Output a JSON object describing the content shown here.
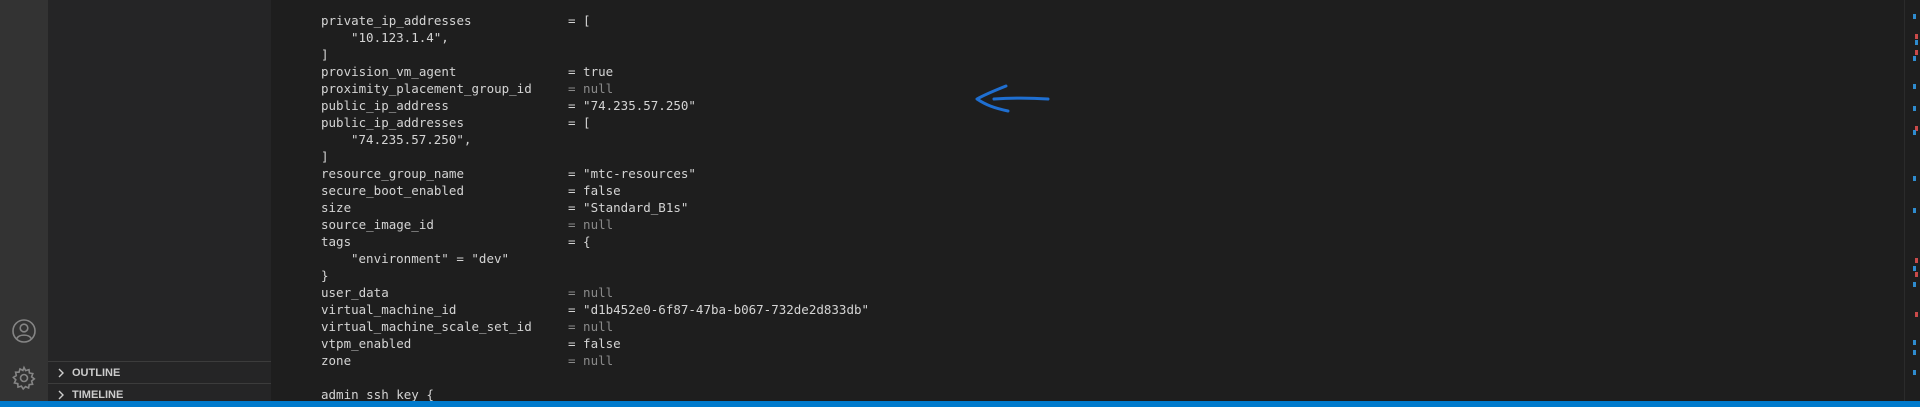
{
  "sidebar": {
    "outline_label": "OUTLINE",
    "timeline_label": "TIMELINE"
  },
  "code_lines": [
    {
      "key": "private_ip_addresses",
      "value": "= [",
      "dim": false
    },
    {
      "indent": "\"10.123.1.4\","
    },
    {
      "raw": "]"
    },
    {
      "key": "provision_vm_agent",
      "value": "= true",
      "dim": false
    },
    {
      "key": "proximity_placement_group_id",
      "value": "= null",
      "dim": true
    },
    {
      "key": "public_ip_address",
      "value": "= \"74.235.57.250\"",
      "dim": false
    },
    {
      "key": "public_ip_addresses",
      "value": "= [",
      "dim": false
    },
    {
      "indent": "\"74.235.57.250\","
    },
    {
      "raw": "]"
    },
    {
      "key": "resource_group_name",
      "value": "= \"mtc-resources\"",
      "dim": false
    },
    {
      "key": "secure_boot_enabled",
      "value": "= false",
      "dim": false
    },
    {
      "key": "size",
      "value": "= \"Standard_B1s\"",
      "dim": false
    },
    {
      "key": "source_image_id",
      "value": "= null",
      "dim": true
    },
    {
      "key": "tags",
      "value": "= {",
      "dim": false
    },
    {
      "indent": "\"environment\" = \"dev\""
    },
    {
      "raw": "}"
    },
    {
      "key": "user_data",
      "value": "= null",
      "dim": true
    },
    {
      "key": "virtual_machine_id",
      "value": "= \"d1b452e0-6f87-47ba-b067-732de2d833db\"",
      "dim": false
    },
    {
      "key": "virtual_machine_scale_set_id",
      "value": "= null",
      "dim": true
    },
    {
      "key": "vtpm_enabled",
      "value": "= false",
      "dim": false
    },
    {
      "key": "zone",
      "value": "= null",
      "dim": true
    },
    {
      "raw": ""
    },
    {
      "raw": "admin_ssh_key {"
    }
  ],
  "colors": {
    "annotation": "#1f6fd1",
    "accent": "#007acc"
  },
  "icons": {
    "account": "account-icon",
    "settings": "gear-icon",
    "chevron": "chevron-right-icon",
    "annotation": "arrow-left-icon"
  }
}
